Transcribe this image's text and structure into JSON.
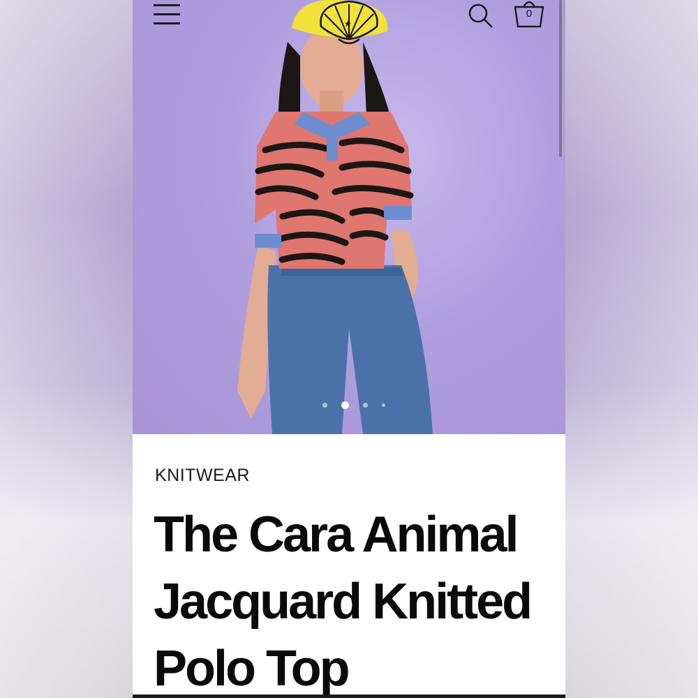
{
  "header": {
    "menu_icon": "hamburger-menu-icon",
    "logo_icon": "seashell-logo-icon",
    "search_icon": "search-icon",
    "basket_icon": "basket-icon",
    "basket_count": "0"
  },
  "carousel": {
    "slides": 4,
    "active_index": 1
  },
  "product": {
    "category": "KNITWEAR",
    "title": "The Cara Animal Jacquard Knitted Polo Top"
  },
  "colors": {
    "hero_background": "#b09fdf",
    "text": "#0a0a0a",
    "hat": "#f1e13a",
    "top_pink": "#df7670",
    "collar_blue": "#6c8ed0",
    "denim": "#4a72a8"
  }
}
